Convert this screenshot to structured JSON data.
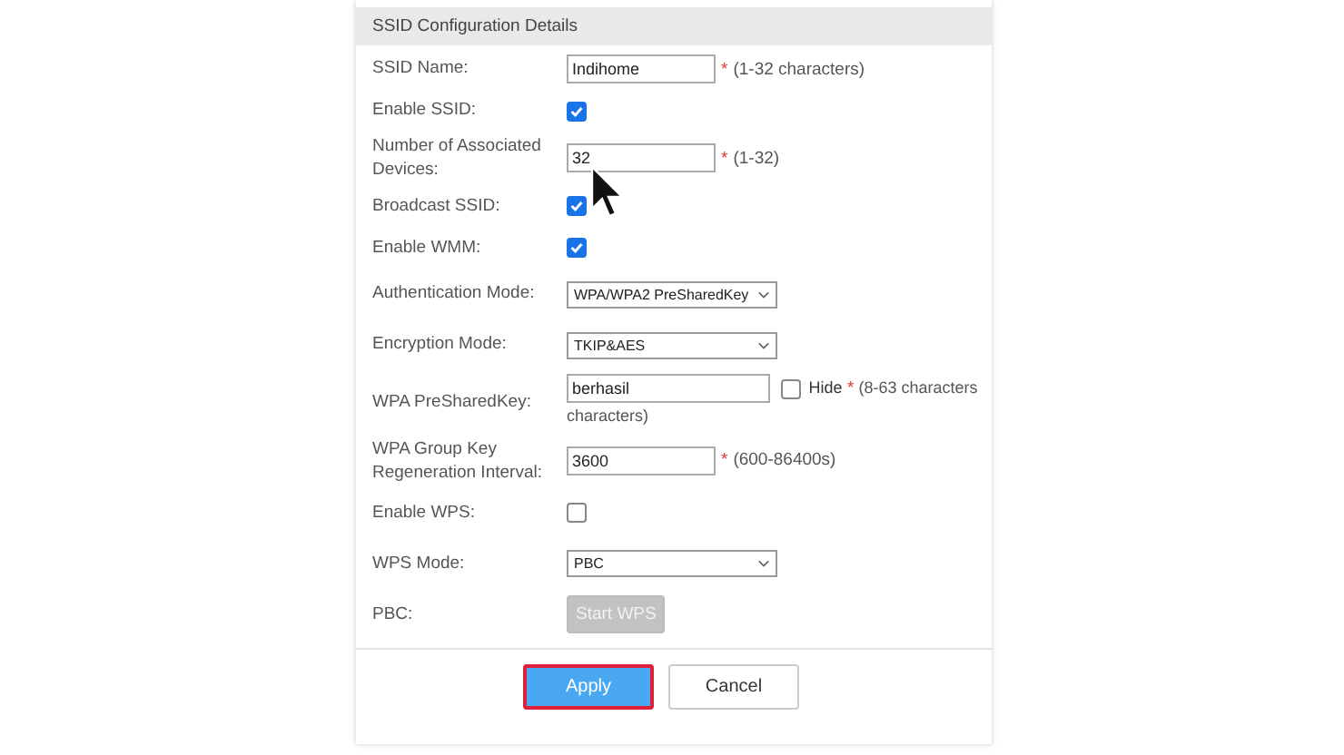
{
  "section": {
    "title": "SSID Configuration Details"
  },
  "fields": [
    {
      "kind": "text",
      "label": "SSID Name:",
      "value": "Indihome",
      "required_mark": "*",
      "note": "(1-32 characters)"
    },
    {
      "kind": "checkbox",
      "label": "Enable SSID:",
      "checked": true
    },
    {
      "kind": "text",
      "label": "Number of Associated Devices:",
      "value": "32",
      "required_mark": "*",
      "note": "(1-32)"
    },
    {
      "kind": "checkbox",
      "label": "Broadcast SSID:",
      "checked": true
    },
    {
      "kind": "checkbox",
      "label": "Enable WMM:",
      "checked": true
    },
    {
      "kind": "select",
      "label": "Authentication Mode:",
      "value": "WPA/WPA2 PreSharedKey"
    },
    {
      "kind": "select",
      "label": "Encryption Mode:",
      "value": "TKIP&AES"
    },
    {
      "kind": "password",
      "label": "WPA PreSharedKey:",
      "value": "berhasil",
      "hide_label": "Hide",
      "hide_checked": false,
      "required_mark": "*",
      "note": "(8-63 characters",
      "note_continued": "characters)"
    },
    {
      "kind": "text",
      "label": "WPA Group Key Regeneration Interval:",
      "value": "3600",
      "required_mark": "*",
      "note": "(600-86400s)"
    },
    {
      "kind": "checkbox",
      "label": "Enable WPS:",
      "checked": false
    },
    {
      "kind": "select",
      "label": "WPS Mode:",
      "value": "PBC"
    },
    {
      "kind": "button",
      "label": "PBC:",
      "button": "Start WPS",
      "disabled": true
    }
  ],
  "actions": [
    {
      "label": "Apply",
      "primary": true,
      "focused": true
    },
    {
      "label": "Cancel",
      "primary": false,
      "focused": false
    }
  ]
}
